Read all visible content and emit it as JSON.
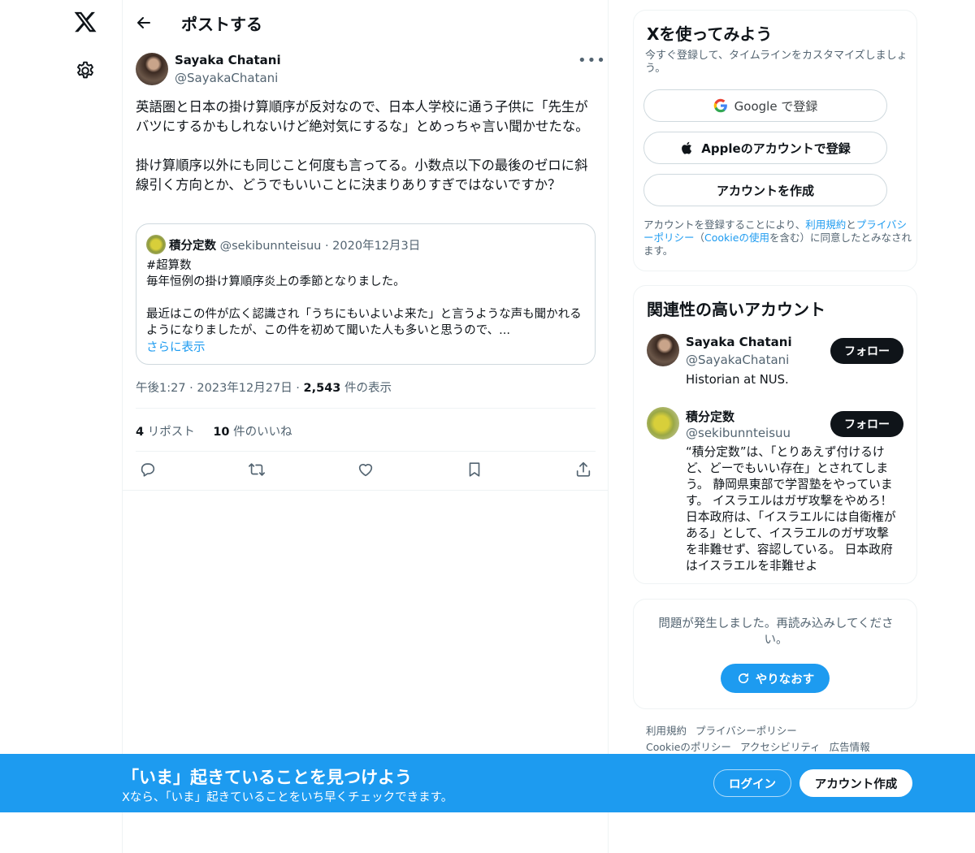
{
  "nav": {
    "logo_icon": "x-logo-icon",
    "settings_icon": "gear-icon"
  },
  "header": {
    "title": "ポストする",
    "back_icon": "arrow-left-icon"
  },
  "tweet": {
    "author_name": "Sayaka Chatani",
    "author_handle": "@SayakaChatani",
    "text": "英語圏と日本の掛け算順序が反対なので、日本人学校に通う子供に「先生がバツにするかもしれないけど絶対気にするな」とめっちゃ言い聞かせたな。\n\n掛け算順序以外にも同じこと何度も言ってる。小数点以下の最後のゼロに斜線引く方向とか、どうでもいいことに決まりありすぎではないですか？",
    "quote": {
      "name": "積分定数",
      "handle": "@sekibunnteisuu",
      "date": "· 2020年12月3日",
      "text": "#超算数\n毎年恒例の掛け算順序炎上の季節となりました。\n\n最近はこの件が広く認識され「うちにもいよいよ来た」と言うような声も聞かれるようになりましたが、この件を初めて聞いた人も多いと思うので、...",
      "show_more": "さらに表示"
    },
    "time": "午後1:27 · 2023年12月27日 · ",
    "views_count": "2,543",
    "views_label": " 件の表示",
    "reposts_count": "4",
    "reposts_label": " リポスト",
    "likes_count": "10",
    "likes_label": " 件のいいね",
    "actions": [
      "reply-icon",
      "repost-icon",
      "like-icon",
      "bookmark-icon",
      "share-icon"
    ]
  },
  "signup": {
    "title": "Xを使ってみよう",
    "subtitle": "今すぐ登録して、タイムラインをカスタマイズしましょう。",
    "google_label": "Google で登録",
    "apple_label": "Appleのアカウントで登録",
    "create_label": "アカウントを作成",
    "legal_1": "アカウントを登録することにより、",
    "legal_terms": "利用規約",
    "legal_2": "と",
    "legal_privacy": "プライバシーポリシー",
    "legal_3": "（",
    "legal_cookie": "Cookieの使用",
    "legal_4": "を含む）に同意したとみなされます。"
  },
  "related": {
    "title": "関連性の高いアカウント",
    "accounts": [
      {
        "name": "Sayaka Chatani",
        "handle": "@SayakaChatani",
        "bio": "Historian at NUS.",
        "follow": "フォロー"
      },
      {
        "name": "積分定数",
        "handle": "@sekibunnteisuu",
        "bio": "“積分定数”は、「とりあえず付けるけど、どーでもいい存在」とされてしまう。 静岡県東部で学習塾をやっています。 イスラエルはガザ攻撃をやめろ！日本政府は、「イスラエルには自衛権がある」として、イスラエルのガザ攻撃を非難せず、容認している。 日本政府はイスラエルを非難せよ",
        "follow": "フォロー"
      }
    ]
  },
  "error": {
    "message": "問題が発生しました。再読み込みしてください。",
    "retry": "やりなおす"
  },
  "footer": {
    "links": [
      "利用規約",
      "プライバシーポリシー",
      "Cookieのポリシー",
      "アクセシビリティ",
      "広告情報"
    ]
  },
  "banner": {
    "title": "「いま」起きていることを見つけよう",
    "subtitle": "Xなら、「いま」起きていることをいち早くチェックできます。",
    "login": "ログイン",
    "signup": "アカウント作成"
  },
  "colors": {
    "accent": "#1d9bf0",
    "text": "#0f1419",
    "muted": "#536471",
    "border": "#eff3f4"
  }
}
